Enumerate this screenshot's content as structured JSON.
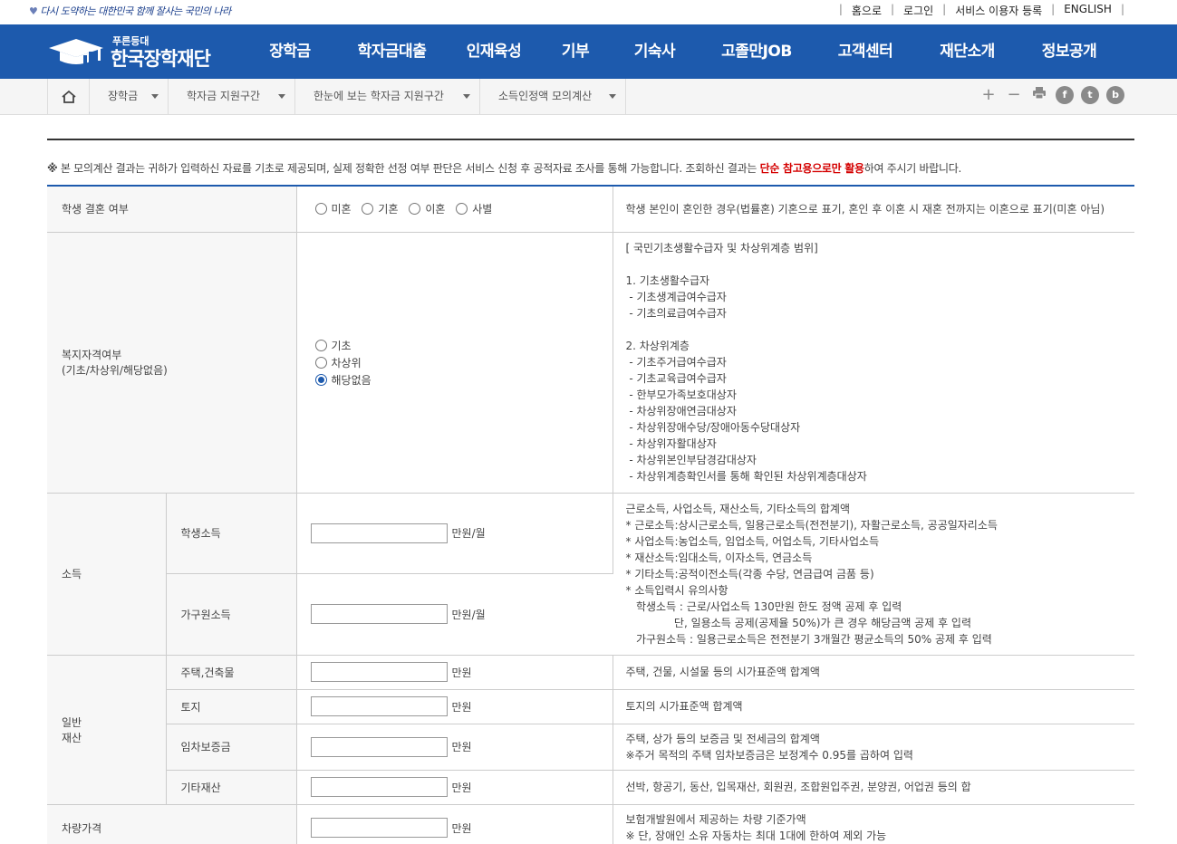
{
  "slogan": "다시 도약하는 대한민국 함께 잘사는 국민의 나라",
  "util_links": [
    "홈으로",
    "로그인",
    "서비스 이용자 등록",
    "ENGLISH"
  ],
  "logo": {
    "sub": "푸른등대",
    "main": "한국장학재단"
  },
  "menu": [
    "장학금",
    "학자금대출",
    "인재육성",
    "기부",
    "기숙사",
    "고졸만JOB",
    "고객센터",
    "재단소개",
    "정보공개"
  ],
  "breadcrumbs": [
    "장학금",
    "학자금 지원구간",
    "한눈에 보는 학자금 지원구간",
    "소득인정액 모의계산"
  ],
  "tools": {
    "zoom_in": "+",
    "zoom_out": "−",
    "print": "print",
    "facebook": "f",
    "twitter": "t",
    "blog": "b"
  },
  "notice": {
    "mark": "※",
    "text_before": " 본 모의계산 결과는 귀하가 입력하신 자료를 기초로 제공되며, 실제 정확한 선정 여부 판단은 서비스 신청 후 공적자료 조사를 통해 가능합니다. 조회하신 결과는 ",
    "highlight": "단순 참고용으로만 활용",
    "text_after": "하여 주시기 바랍니다."
  },
  "marriage": {
    "label": "학생 결혼 여부",
    "options": [
      "미혼",
      "기혼",
      "이혼",
      "사별"
    ],
    "desc": "학생 본인이 혼인한 경우(법률혼) 기혼으로 표기, 혼인 후 이혼 시 재혼 전까지는 이혼으로 표기(미혼 아님)"
  },
  "welfare": {
    "label_line1": "복지자격여부",
    "label_line2": "(기초/차상위/해당없음)",
    "options": [
      "기초",
      "차상위",
      "해당없음"
    ],
    "selected": "해당없음",
    "desc": "[ 국민기초생활수급자 및 차상위계층 범위]\n\n1. 기초생활수급자\n - 기초생계급여수급자\n - 기초의료급여수급자\n\n2. 차상위계층\n - 기초주거급여수급자\n - 기초교육급여수급자\n - 한부모가족보호대상자\n - 차상위장애연금대상자\n - 차상위장애수당/장애아동수당대상자\n - 차상위자활대상자\n - 차상위본인부담경감대상자\n - 차상위계층확인서를 통해 확인된 차상위계층대상자"
  },
  "income": {
    "group_label": "소득",
    "student_label": "학생소득",
    "family_label": "가구원소득",
    "unit": "만원/월",
    "student_value": "",
    "family_value": "",
    "desc": "근로소득, 사업소득, 재산소득, 기타소득의 합계액\n* 근로소득:상시근로소득, 일용근로소득(전전분기), 자활근로소득, 공공일자리소득\n* 사업소득:농업소득, 임업소득, 어업소득, 기타사업소득\n* 재산소득:임대소득, 이자소득, 연금소득\n* 기타소득:공적이전소득(각종 수당, 연금급여 금품 등)\n* 소득입력시 유의사항\n   학생소득 : 근로/사업소득 130만원 한도 정액 공제 후 입력\n              단, 일용소득 공제(공제율 50%)가 큰 경우 해당금액 공제 후 입력\n   가구원소득 : 일용근로소득은 전전분기 3개월간 평균소득의 50% 공제 후 입력"
  },
  "property": {
    "group_line1": "일반",
    "group_line2": "재산",
    "unit": "만원",
    "rows": [
      {
        "label": "주택,건축물",
        "value": "",
        "desc": "주택, 건물, 시설물 등의 시가표준액 합계액"
      },
      {
        "label": "토지",
        "value": "",
        "desc": "토지의 시가표준액 합계액"
      },
      {
        "label": "임차보증금",
        "value": "",
        "desc": "주택, 상가 등의 보증금 및 전세금의 합계액\n※주거 목적의 주택 임차보증금은 보정계수 0.95를 곱하여 입력"
      },
      {
        "label": "기타재산",
        "value": "",
        "desc": "선박, 항공기, 동산, 입목재산, 회원권, 조합원입주권, 분양권, 어업권 등의 합"
      }
    ]
  },
  "vehicle": {
    "label": "차량가격",
    "unit": "만원",
    "value": "",
    "desc": "보험개발원에서 제공하는 차량 기준가액\n※ 단, 장애인 소유 자동차는 최대 1대에 한하여 제외 가능"
  },
  "colors": {
    "brand": "#1d5aad",
    "highlight": "#d40000"
  }
}
